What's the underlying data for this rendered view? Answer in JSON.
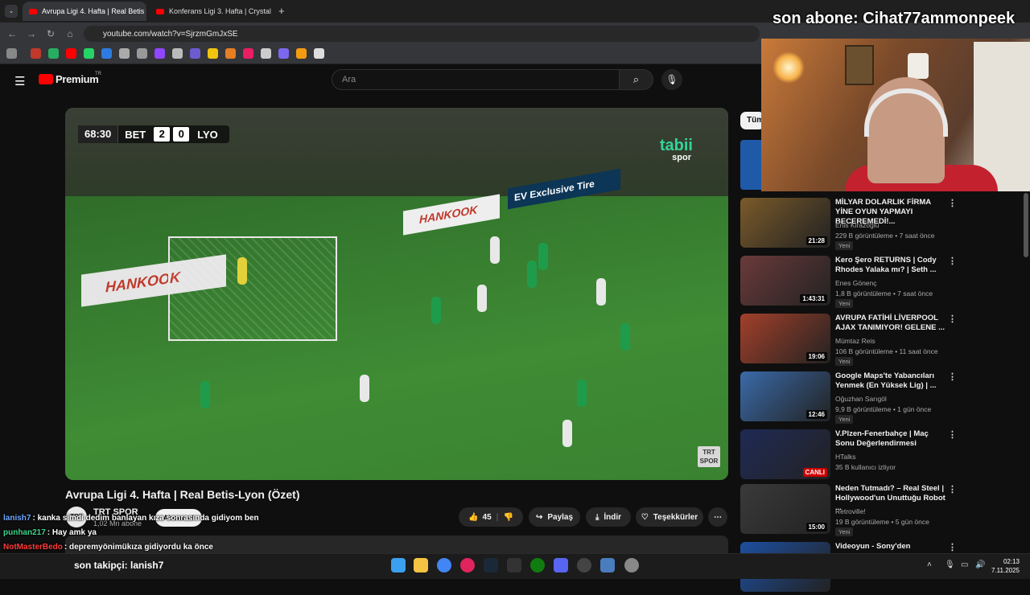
{
  "tabs": [
    {
      "label": "Avrupa Ligi 4. Hafta | Real Betis",
      "active": true
    },
    {
      "label": "Konferans Ligi 3. Hafta | Crystal",
      "active": false
    }
  ],
  "address": {
    "url": "youtube.com/watch?v=SjrzmGmJxSE"
  },
  "youtube": {
    "logo_label": "Premium",
    "logo_badge": "TR",
    "search_placeholder": "Ara",
    "search_icon": "search-icon",
    "mic_icon": "mic-icon"
  },
  "video": {
    "score_time": "68:30",
    "home_team": "BET",
    "home_score": "2",
    "away_score": "0",
    "away_team": "LYO",
    "broadcaster": "tabii",
    "broadcaster_sub": "spor",
    "corner_logo": "TRT SPOR",
    "ad_text_1": "HANKOOK",
    "ad_text_2": "EV Exclusive Tire"
  },
  "watch": {
    "title": "Avrupa Ligi 4. Hafta | Real Betis-Lyon (Özet)",
    "channel": "TRT SPOR",
    "channel_avatar": "TRT",
    "subscribers": "1,02 Mn abone",
    "subscribe_label": "Abone ol",
    "likes": "45",
    "share_label": "Paylaş",
    "download_label": "İndir",
    "thanks_label": "Teşekkürler",
    "more_label": "⋯"
  },
  "chips": {
    "first": "Tüm"
  },
  "sidebar": [
    {
      "title": "MİLYAR DOLARLIK FİRMA YİNE OYUN YAPMAYI BECEREMEDİ!...",
      "channel": "Enis Kirazoglu",
      "meta": "229 B görüntüleme • 7 saat önce",
      "duration": "21:28",
      "badge": "Yeni",
      "color": "#7a5a2a"
    },
    {
      "title": "Kero Şero RETURNS | Cody Rhodes Yalaka mı? | Seth ...",
      "channel": "Enes Gönenç",
      "meta": "1,8 B görüntüleme • 7 saat önce",
      "duration": "1:43:31",
      "badge": "Yeni",
      "color": "#6b3a3a"
    },
    {
      "title": "AVRUPA FATİHİ LİVERPOOL AJAX TANIMIYOR! GELENE ...",
      "channel": "Mümtaz Reis",
      "meta": "106 B görüntüleme • 11 saat önce",
      "duration": "19:06",
      "badge": "Yeni",
      "color": "#a3402a"
    },
    {
      "title": "Google Maps'te Yabancıları Yenmek (En Yüksek Lig) | ...",
      "channel": "Oğuzhan Sarıgöl",
      "meta": "9,9 B görüntüleme • 1 gün önce",
      "duration": "12:46",
      "badge": "Yeni",
      "color": "#3a6aa8"
    },
    {
      "title": "V.Plzen-Fenerbahçe | Maç Sonu Değerlendirmesi",
      "channel": "HTalks",
      "meta": "35 B kullanıcı izliyor",
      "duration": "CANLI",
      "badge": "",
      "color": "#1f2a55"
    },
    {
      "title": "Neden Tutmadı? – Real Steel | Hollywood'un Unuttuğu Robot ...",
      "channel": "Retroville!",
      "meta": "19 B görüntüleme • 5 gün önce",
      "duration": "15:00",
      "badge": "Yeni",
      "color": "#3a3a3a"
    },
    {
      "title": "Videoyun - Sony'den",
      "channel": "",
      "meta": "",
      "duration": "",
      "badge": "",
      "color": "#1d4fa0"
    }
  ],
  "stream": {
    "last_subscriber": "son abone: Cihat77ammonpeek",
    "last_follower": "son takipçi: lanish7",
    "chat": [
      {
        "user": "lanish7",
        "color": "#6fa8ff",
        "text": ": kanka simdi dedim banlayan kıza sonrasında gidiyom ben"
      },
      {
        "user": "punhan217",
        "color": "#3fd48a",
        "text": ": Hay amk ya"
      },
      {
        "user": "NotMasterBedo",
        "color": "#ff3b3b",
        "text": ": depremyönimükıza gidiyordu ka önce"
      }
    ]
  },
  "clock": {
    "time": "02:13",
    "date": "7.11.2025"
  }
}
